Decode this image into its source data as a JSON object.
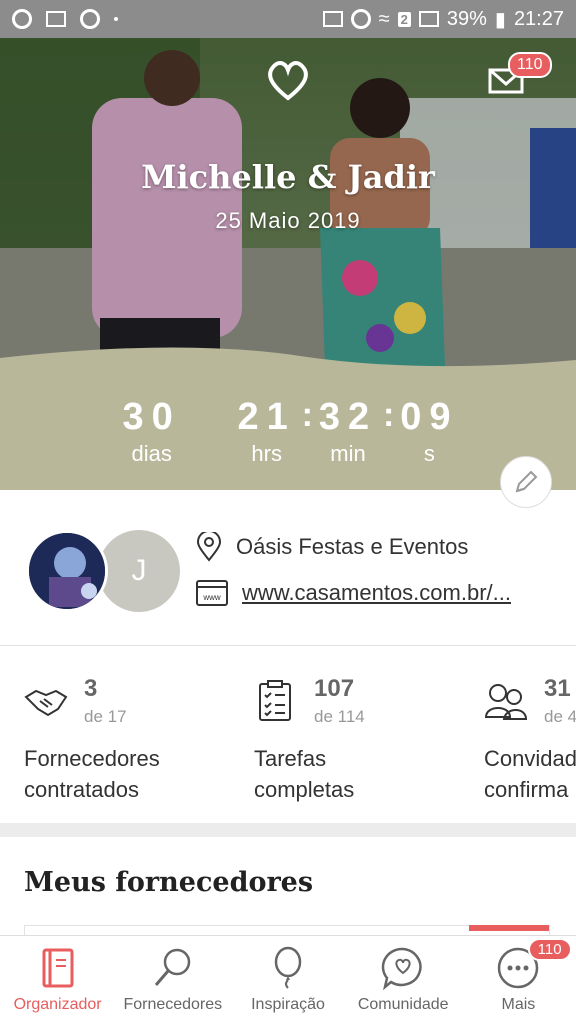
{
  "status_bar": {
    "battery": "39%",
    "time": "21:27",
    "sim_badge": "2"
  },
  "hero": {
    "couple_names": "Michelle & Jadir",
    "wedding_date": "25 Maio 2019",
    "mail_badge": "110"
  },
  "countdown": {
    "days": "30",
    "days_label": "dias",
    "hours": "21",
    "hours_label": "hrs",
    "minutes": "32",
    "minutes_label": "min",
    "seconds": "09",
    "seconds_label": "s"
  },
  "vendor": {
    "avatar_initial": "J",
    "venue": "Oásis Festas e Eventos",
    "website": "www.casamentos.com.br/..."
  },
  "stats": [
    {
      "value": "3",
      "total": "de 17",
      "label_line1": "Fornecedores",
      "label_line2": "contratados"
    },
    {
      "value": "107",
      "total": "de 114",
      "label_line1": "Tarefas",
      "label_line2": "completas"
    },
    {
      "value": "31",
      "total": "de 4",
      "label_line1": "Convidad",
      "label_line2": "confirma"
    }
  ],
  "section": {
    "title": "Meus fornecedores"
  },
  "bottom_nav": [
    {
      "label": "Organizador",
      "icon": "notebook-icon"
    },
    {
      "label": "Fornecedores",
      "icon": "magnifier-icon"
    },
    {
      "label": "Inspiração",
      "icon": "balloon-icon"
    },
    {
      "label": "Comunidade",
      "icon": "chat-heart-icon"
    },
    {
      "label": "Mais",
      "icon": "more-dots-icon",
      "badge": "110"
    }
  ],
  "colors": {
    "accent": "#e85d5d",
    "hero_band": "#b9b79a",
    "status_bar": "#8c8c8c"
  }
}
